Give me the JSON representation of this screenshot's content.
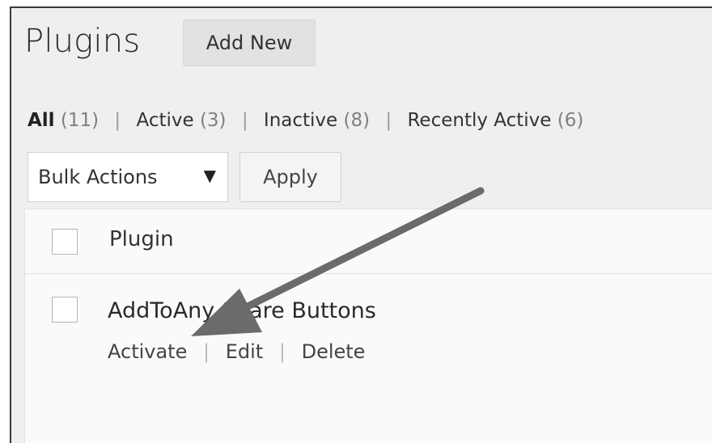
{
  "header": {
    "title": "Plugins",
    "add_new_label": "Add New"
  },
  "filters": {
    "all_label": "All",
    "all_count": "(11)",
    "active_label": "Active",
    "active_count": "(3)",
    "inactive_label": "Inactive",
    "inactive_count": "(8)",
    "recent_label": "Recently Active",
    "recent_count": "(6)",
    "separator": "|"
  },
  "bulk_actions": {
    "selected": "Bulk Actions",
    "caret": "▼",
    "apply_label": "Apply"
  },
  "table": {
    "column_plugin": "Plugin",
    "rows": [
      {
        "name": "AddToAny Share Buttons",
        "actions": [
          "Activate",
          "Edit",
          "Delete"
        ],
        "action_separator": "|"
      }
    ]
  },
  "colors": {
    "frame_bg": "#efefef",
    "arrow": "#6b6b6b"
  }
}
